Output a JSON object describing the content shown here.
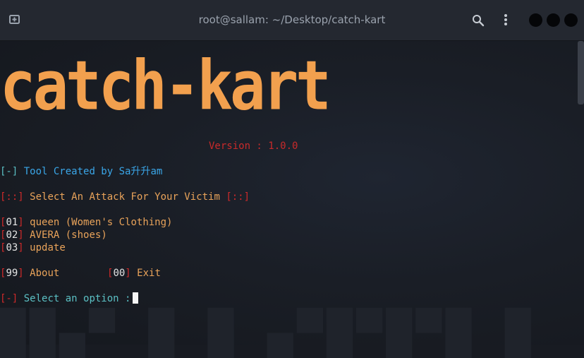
{
  "window": {
    "title": "root@sallam: ~/Desktop/catch-kart"
  },
  "banner": "catch-kart",
  "version": "Version : 1.0.0",
  "credit": {
    "bracket": "[-]",
    "text": "Tool Created by Sa升升am"
  },
  "prompt_header": {
    "open": "[::]",
    "text": "Select An Attack For Your Victim",
    "close": "[::]"
  },
  "options": [
    {
      "num": "01",
      "label": "queen (Women's Clothing)"
    },
    {
      "num": "02",
      "label": "AVERA (shoes)"
    },
    {
      "num": "03",
      "label": "update"
    }
  ],
  "extra_options": [
    {
      "num": "99",
      "label": "About"
    },
    {
      "num": "00",
      "label": "Exit"
    }
  ],
  "input_prompt": {
    "bracket": "[-]",
    "text": "Select an option :"
  },
  "colors": {
    "banner": "#f2a04e",
    "red": "#cf2a2a",
    "blue": "#3aa6e8",
    "orange": "#e9a35a",
    "cyan": "#5bc0c4"
  }
}
